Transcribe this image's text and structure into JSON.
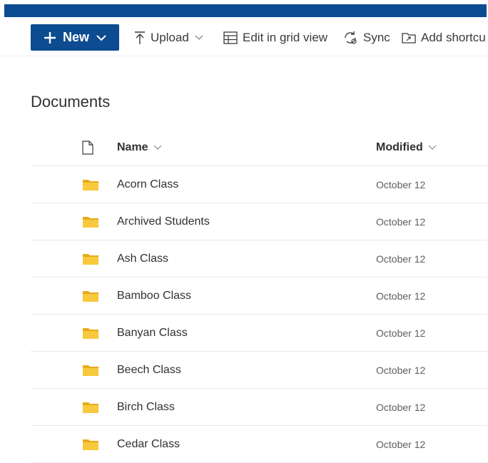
{
  "commandbar": {
    "new_label": "New",
    "upload_label": "Upload",
    "edit_grid_label": "Edit in grid view",
    "sync_label": "Sync",
    "add_shortcut_label": "Add shortcu"
  },
  "page": {
    "title": "Documents"
  },
  "list": {
    "columns": {
      "name": "Name",
      "modified": "Modified"
    },
    "rows": [
      {
        "name": "Acorn Class",
        "modified": "October 12"
      },
      {
        "name": "Archived Students",
        "modified": "October 12"
      },
      {
        "name": "Ash Class",
        "modified": "October 12"
      },
      {
        "name": "Bamboo Class",
        "modified": "October 12"
      },
      {
        "name": "Banyan Class",
        "modified": "October 12"
      },
      {
        "name": "Beech Class",
        "modified": "October 12"
      },
      {
        "name": "Birch Class",
        "modified": "October 12"
      },
      {
        "name": "Cedar Class",
        "modified": "October 12"
      }
    ]
  },
  "colors": {
    "brand": "#0d4c91",
    "folder": "#f8c93d",
    "folder_dark": "#e8aa18"
  },
  "icons": {
    "plus": "plus-icon",
    "chevron": "chevron-down-icon",
    "upload": "upload-icon",
    "grid": "grid-view-icon",
    "sync": "sync-icon",
    "shortcut": "add-shortcut-icon",
    "file": "file-type-icon",
    "folder": "folder-icon"
  }
}
